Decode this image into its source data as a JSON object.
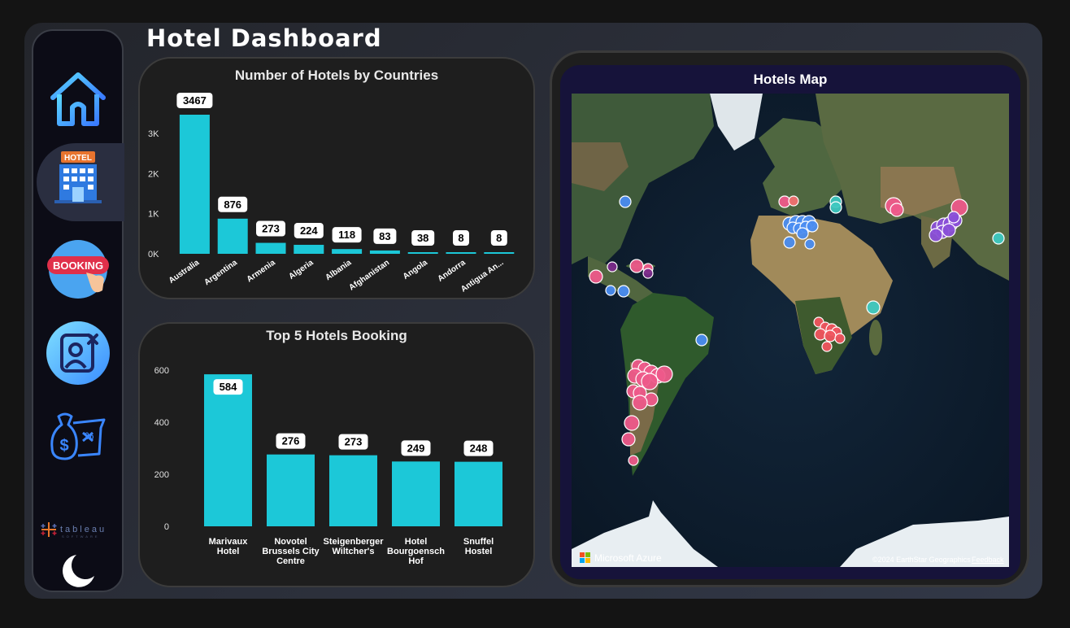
{
  "title": "Hotel Dashboard",
  "nav": {
    "items": [
      {
        "name": "home-icon"
      },
      {
        "name": "hotel-icon",
        "sign": "HOTEL",
        "active": true
      },
      {
        "name": "booking-icon",
        "sign": "BOOKING"
      },
      {
        "name": "cancel-user-icon"
      },
      {
        "name": "money-bag-icon"
      }
    ],
    "brand": "tableau",
    "brand_sub": "SOFTWARE",
    "theme_toggle": "moon-icon"
  },
  "countries_chart": {
    "title": "Number of Hotels by Countries",
    "chart_data": {
      "type": "bar",
      "categories": [
        "Australia",
        "Argentina",
        "Armenia",
        "Algeria",
        "Albania",
        "Afghanistan",
        "Angola",
        "Andorra",
        "Antigua An..."
      ],
      "values": [
        3467,
        876,
        273,
        224,
        118,
        83,
        38,
        8,
        8
      ],
      "ylim": [
        0,
        3467
      ],
      "yticks": [
        "0K",
        "1K",
        "2K",
        "3K"
      ],
      "color": "#1cc8d8"
    }
  },
  "top5_chart": {
    "title": "Top 5 Hotels Booking",
    "chart_data": {
      "type": "bar",
      "categories": [
        [
          "Marivaux",
          "Hotel"
        ],
        [
          "Novotel",
          "Brussels City",
          "Centre"
        ],
        [
          "Steigenberger",
          "Wiltcher's"
        ],
        [
          "Hotel",
          "Bourgoensch",
          "Hof"
        ],
        [
          "Snuffel",
          "Hostel"
        ]
      ],
      "values": [
        584,
        276,
        273,
        249,
        248
      ],
      "ylim": [
        0,
        600
      ],
      "yticks": [
        "0",
        "200",
        "400",
        "600"
      ],
      "color": "#1cc8d8"
    }
  },
  "map": {
    "title": "Hotels Map",
    "attribution_brand": "Microsoft Azure",
    "copyright": "©2024 EarthStar Geographics",
    "feedback": "Feedback"
  }
}
